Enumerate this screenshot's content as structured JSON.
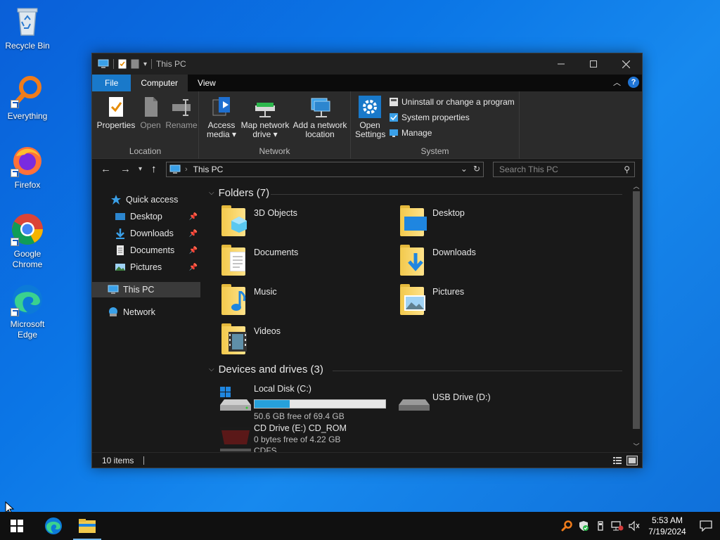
{
  "desktop": {
    "icons": [
      {
        "label": "Recycle Bin",
        "icon": "recycle-bin-icon"
      },
      {
        "label": "Everything",
        "icon": "everything-search-icon"
      },
      {
        "label": "Firefox",
        "icon": "firefox-icon"
      },
      {
        "label": "Google Chrome",
        "icon": "chrome-icon"
      },
      {
        "label": "Microsoft Edge",
        "icon": "edge-icon"
      }
    ]
  },
  "window": {
    "title": "This PC",
    "ribbon_tabs": [
      "File",
      "Computer",
      "View"
    ],
    "active_tab": "Computer",
    "ribbon": {
      "location": {
        "label": "Location",
        "buttons": [
          "Properties",
          "Open",
          "Rename"
        ]
      },
      "network": {
        "label": "Network",
        "access_media_1": "Access",
        "access_media_2": "media ▾",
        "map_drive_1": "Map network",
        "map_drive_2": "drive ▾",
        "add_location_1": "Add a network",
        "add_location_2": "location"
      },
      "system": {
        "label": "System",
        "open_settings_1": "Open",
        "open_settings_2": "Settings",
        "uninstall": "Uninstall or change a program",
        "system_properties": "System properties",
        "manage": "Manage"
      }
    },
    "address": {
      "crumb": "This PC",
      "search_placeholder": "Search This PC"
    },
    "nav_pane": {
      "quick_access": "Quick access",
      "quick_items": [
        "Desktop",
        "Downloads",
        "Documents",
        "Pictures"
      ],
      "this_pc": "This PC",
      "network": "Network"
    },
    "folders_group": {
      "title": "Folders (7)",
      "items": [
        "3D Objects",
        "Desktop",
        "Documents",
        "Downloads",
        "Music",
        "Pictures",
        "Videos"
      ]
    },
    "drives_group": {
      "title": "Devices and drives (3)",
      "local_disk": {
        "name": "Local Disk (C:)",
        "free": "50.6 GB free of 69.4 GB",
        "used_fraction": 0.271
      },
      "usb": {
        "name": "USB Drive (D:)"
      },
      "cd": {
        "name": "CD Drive (E:) CD_ROM",
        "free": "0 bytes free of 4.22 GB",
        "fs": "CDFS"
      }
    },
    "status": {
      "items": "10 items"
    }
  },
  "taskbar": {
    "time": "5:53 AM",
    "date": "7/19/2024"
  },
  "colors": {
    "accent": "#1979ca",
    "capacity": "#26a0da",
    "window_bg": "#191919",
    "ribbon_bg": "#2b2b2b"
  }
}
